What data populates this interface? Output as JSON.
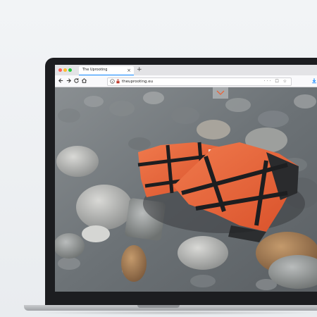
{
  "browser": {
    "tab_title": "The Uprooting",
    "tab_close": "×",
    "new_tab": "+",
    "url": "theuprooting.eu",
    "url_actions": "··· ☐ ☆"
  },
  "colors": {
    "traffic_close": "#ff5f57",
    "traffic_min": "#febc2e",
    "traffic_max": "#28c840",
    "accent": "#0a84ff",
    "life_vest": "#e8643a"
  },
  "icons": {
    "back": "back-arrow-icon",
    "forward": "forward-arrow-icon",
    "reload": "reload-icon",
    "home": "home-icon",
    "info": "info-icon",
    "lock": "lock-icon",
    "download": "download-icon",
    "scroll_down": "chevron-down-icon"
  },
  "hero_image": {
    "subject": "orange life vests on river stones"
  }
}
